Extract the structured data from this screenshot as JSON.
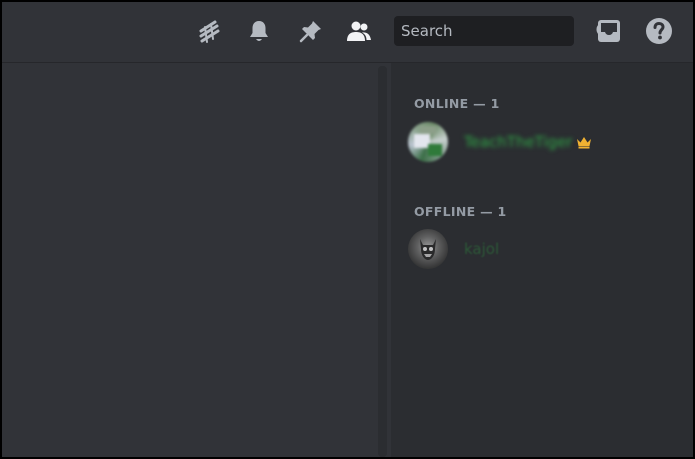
{
  "toolbar": {
    "icons": [
      "threads-icon",
      "bell-icon",
      "pin-icon",
      "member-list-icon",
      "inbox-icon",
      "help-icon"
    ],
    "search": {
      "placeholder": "Search",
      "value": ""
    }
  },
  "members": {
    "online_header": "ONLINE — 1",
    "offline_header": "OFFLINE — 1",
    "online": [
      {
        "name": "TeachTheTiger",
        "owner": true,
        "name_color": "#2fa546"
      }
    ],
    "offline": [
      {
        "name": "kajol",
        "owner": false,
        "name_color": "#2f8a40"
      }
    ]
  },
  "colors": {
    "toolbar_bg": "#313338",
    "sidebar_bg": "#2b2d31",
    "search_bg": "#1e1f22",
    "icon": "#b5bac1",
    "icon_active": "#f2f3f5",
    "header_text": "#949ba4",
    "crown": "#f0b232"
  }
}
